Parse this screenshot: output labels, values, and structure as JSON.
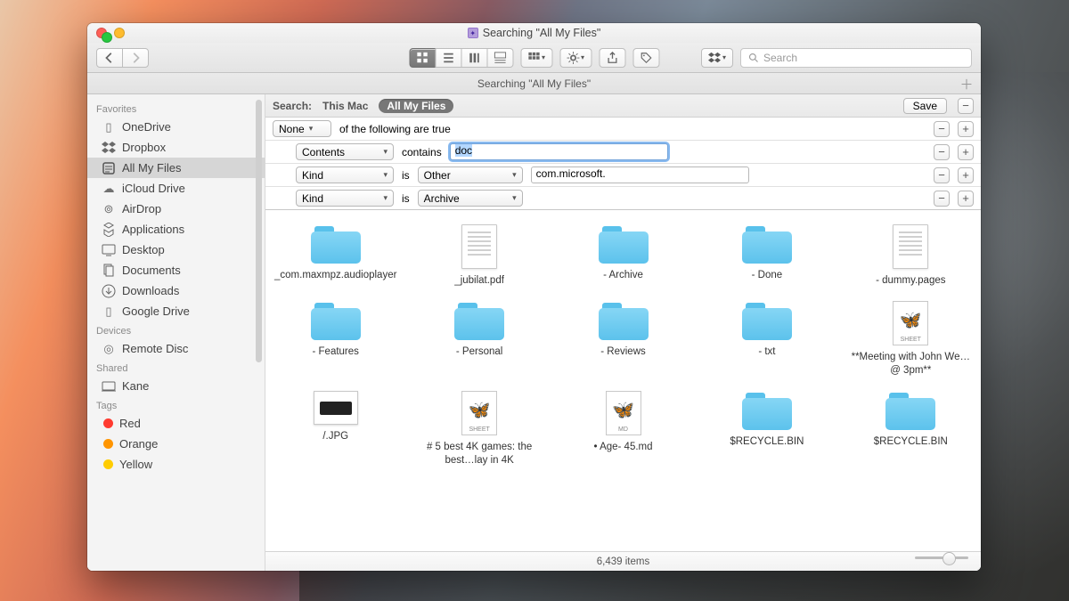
{
  "window": {
    "title": "Searching \"All My Files\""
  },
  "toolbar": {
    "search_placeholder": "Search"
  },
  "tab": {
    "label": "Searching \"All My Files\""
  },
  "sidebar": {
    "sections": {
      "favorites": "Favorites",
      "devices": "Devices",
      "shared": "Shared",
      "tags": "Tags"
    },
    "favorites": [
      {
        "label": "OneDrive"
      },
      {
        "label": "Dropbox"
      },
      {
        "label": "All My Files",
        "selected": true
      },
      {
        "label": "iCloud Drive"
      },
      {
        "label": "AirDrop"
      },
      {
        "label": "Applications"
      },
      {
        "label": "Desktop"
      },
      {
        "label": "Documents"
      },
      {
        "label": "Downloads"
      },
      {
        "label": "Google Drive"
      }
    ],
    "devices": [
      {
        "label": "Remote Disc"
      }
    ],
    "shared": [
      {
        "label": "Kane"
      }
    ],
    "tags": [
      {
        "label": "Red",
        "color": "#ff3b30"
      },
      {
        "label": "Orange",
        "color": "#ff9500"
      },
      {
        "label": "Yellow",
        "color": "#ffcc00"
      }
    ]
  },
  "scope": {
    "label": "Search:",
    "this_mac": "This Mac",
    "all_my_files": "All My Files",
    "save": "Save"
  },
  "criteria": {
    "row0": {
      "sel": "None",
      "text": "of the following are true"
    },
    "row1": {
      "attr": "Contents",
      "op": "contains",
      "value": "doc"
    },
    "row2": {
      "attr": "Kind",
      "op": "is",
      "value_sel": "Other",
      "value_text": "com.microsoft."
    },
    "row3": {
      "attr": "Kind",
      "op": "is",
      "value_sel": "Archive"
    }
  },
  "results": [
    {
      "type": "folder",
      "name": "_com.maxmpz.audioplayer"
    },
    {
      "type": "page",
      "name": "_jubilat.pdf"
    },
    {
      "type": "folder",
      "name": "- Archive"
    },
    {
      "type": "folder",
      "name": "- Done"
    },
    {
      "type": "page",
      "name": "- dummy.pages"
    },
    {
      "type": "folder",
      "name": "- Features"
    },
    {
      "type": "folder",
      "name": "- Personal"
    },
    {
      "type": "folder",
      "name": "- Reviews"
    },
    {
      "type": "folder",
      "name": "- txt"
    },
    {
      "type": "sheet",
      "name": "**Meeting with John We…@ 3pm**"
    },
    {
      "type": "jpg",
      "name": "/.JPG"
    },
    {
      "type": "sheet",
      "name": "# 5 best 4K games: the best…lay in 4K"
    },
    {
      "type": "md",
      "name": "• Age- 45.md"
    },
    {
      "type": "folder",
      "name": "$RECYCLE.BIN"
    },
    {
      "type": "folder",
      "name": "$RECYCLE.BIN"
    }
  ],
  "status": {
    "count": "6,439 items"
  }
}
